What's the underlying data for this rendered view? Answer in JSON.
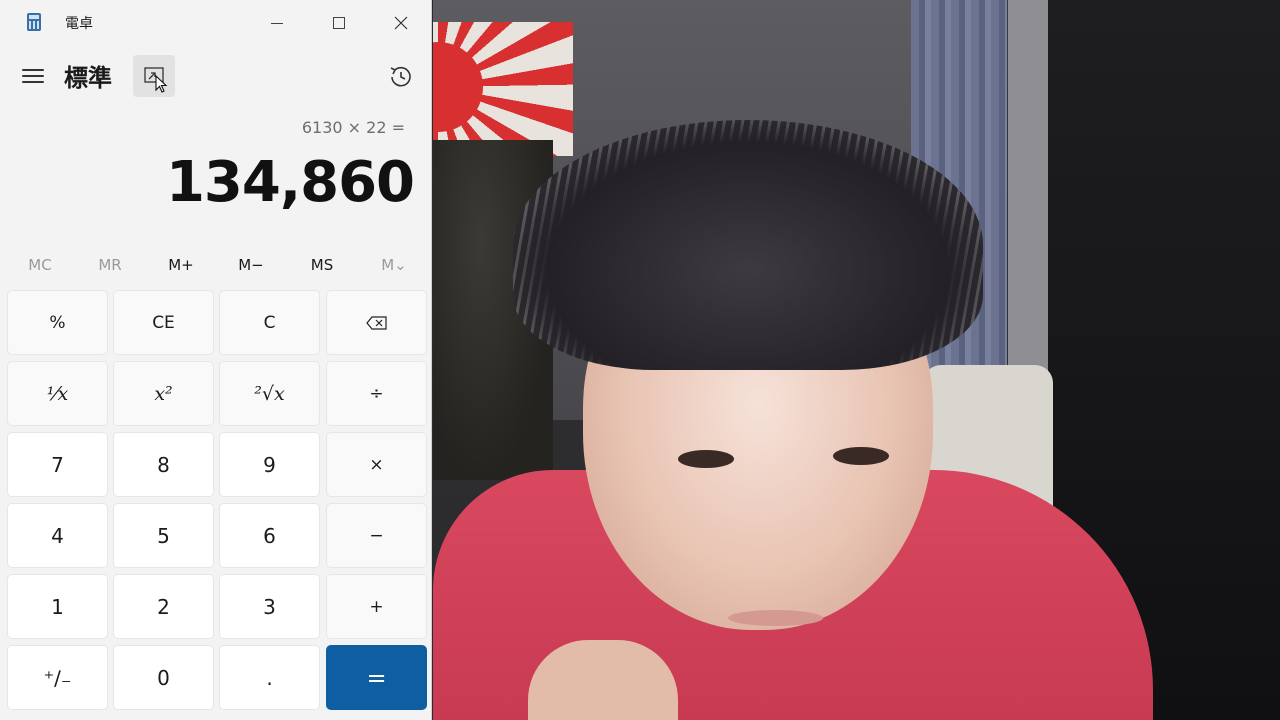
{
  "window": {
    "title": "電卓",
    "app_icon": "calculator-icon"
  },
  "header": {
    "mode_title": "標準",
    "menu_icon": "hamburger-menu-icon",
    "keep_on_top_icon": "keep-on-top-icon",
    "history_icon": "history-icon"
  },
  "display": {
    "expression": "6130 × 22 =",
    "result": "134,860"
  },
  "memory": [
    {
      "label": "MC",
      "enabled": false
    },
    {
      "label": "MR",
      "enabled": false
    },
    {
      "label": "M+",
      "enabled": true
    },
    {
      "label": "M−",
      "enabled": true
    },
    {
      "label": "MS",
      "enabled": true
    },
    {
      "label": "M⌄",
      "enabled": false
    }
  ],
  "keys": {
    "percent": "%",
    "ce": "CE",
    "c": "C",
    "backspace": "⌫",
    "reciprocal": "⅟x",
    "square": "x²",
    "sqrt": "²√x",
    "divide": "÷",
    "seven": "7",
    "eight": "8",
    "nine": "9",
    "multiply": "×",
    "four": "4",
    "five": "5",
    "six": "6",
    "minus": "−",
    "one": "1",
    "two": "2",
    "three": "3",
    "plus": "+",
    "negate": "⁺∕₋",
    "zero": "0",
    "decimal": ".",
    "equals": "="
  },
  "colors": {
    "equals_bg": "#0f5ea3",
    "window_bg": "#f3f3f3",
    "shirt": "#d9485f"
  }
}
